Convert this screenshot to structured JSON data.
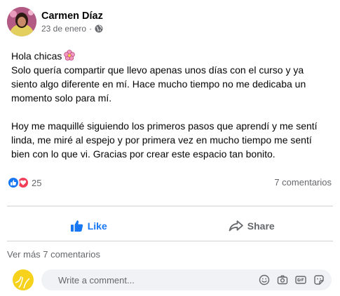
{
  "post": {
    "author": "Carmen Díaz",
    "date": "23 de enero",
    "separator": "·",
    "privacy_icon": "globe-icon",
    "body": {
      "line1": "Hola chicas",
      "emoji": "pink-flower-emoji",
      "paragraph1": "Solo quería compartir que llevo apenas unos días con el curso y ya siento algo diferente en mí. Hace mucho tiempo no me dedicaba un momento solo para mí.",
      "paragraph2": "Hoy me maquillé siguiendo los primeros pasos que aprendí y me sentí linda, me miré al espejo y por primera vez en mucho tiempo me sentí bien con lo que vi. Gracias por crear este espacio tan bonito."
    },
    "reactions": {
      "types": [
        "like",
        "love"
      ],
      "count": "25"
    },
    "comments_count": "7 comentarios"
  },
  "actions": {
    "like_label": "Like",
    "share_label": "Share"
  },
  "comments": {
    "view_more": "Ver más 7 comentarios"
  },
  "composer": {
    "placeholder": "Write a comment...",
    "icons": [
      "emoji-icon",
      "camera-icon",
      "gif-icon",
      "sticker-icon"
    ]
  },
  "colors": {
    "brand_blue": "#1877f2",
    "love_red": "#f33e58",
    "secondary_text": "#65676b",
    "input_bg": "#f0f2f5"
  }
}
